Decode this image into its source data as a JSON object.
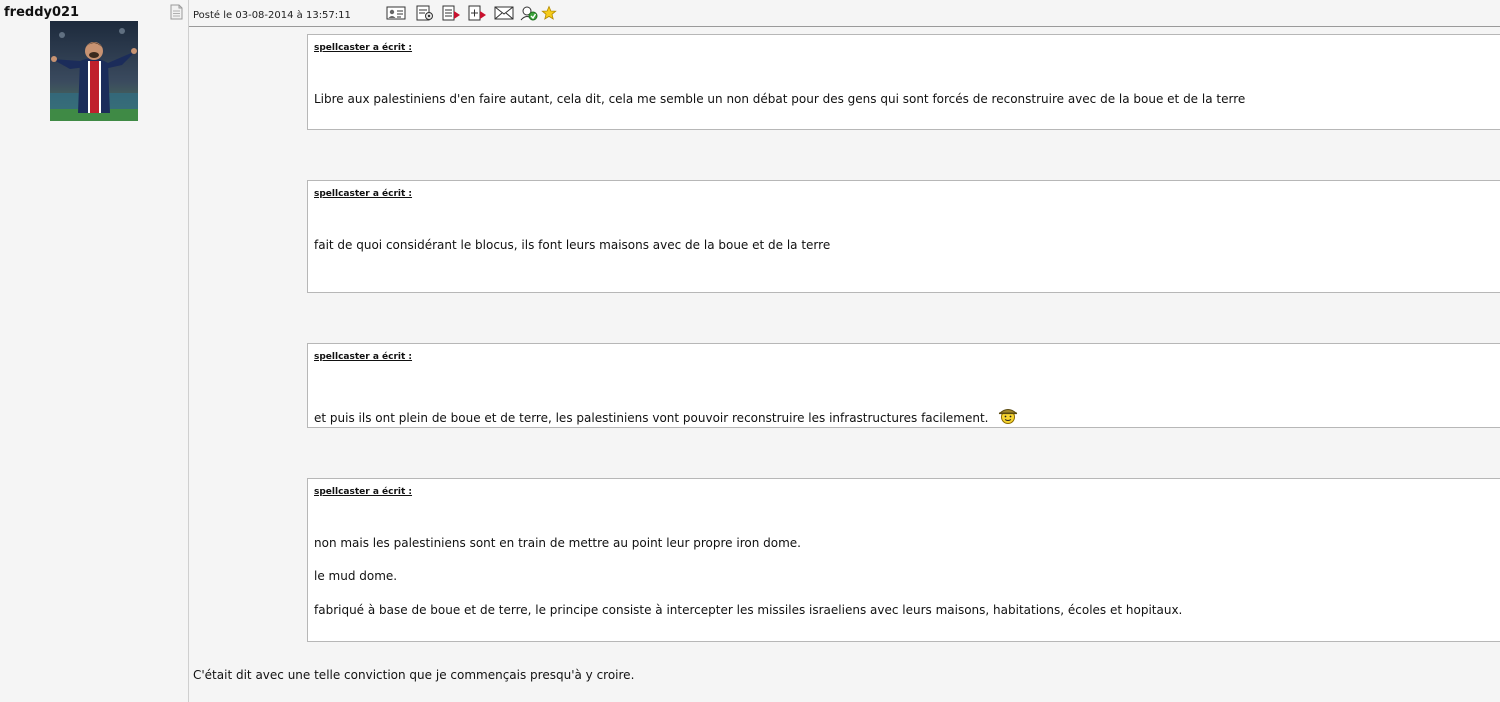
{
  "author": {
    "username": "freddy021",
    "avatar_icon": "football-player-avatar",
    "profile_icon": "profile-page-icon"
  },
  "post": {
    "posted_label": "Posté le 03-08-2014 à 13:57:11",
    "toolbar_icons": [
      "profile-card-icon",
      "contacts-icon",
      "quote-icon",
      "multi-quote-icon",
      "private-message-icon",
      "alert-icon",
      "favorite-star-icon"
    ],
    "quotes": [
      {
        "author": "spellcaster a écrit :",
        "lines": [
          "Libre aux palestiniens d'en faire autant, cela dit, cela me semble un non débat pour des gens qui sont forcés de reconstruire avec de la boue et de la terre"
        ]
      },
      {
        "author": "spellcaster a écrit :",
        "lines": [
          "fait de quoi considérant le blocus, ils font leurs maisons avec de la boue et de la terre"
        ]
      },
      {
        "author": "spellcaster a écrit :",
        "lines": [
          "et puis ils ont plein de boue et de terre, les palestiniens vont pouvoir reconstruire les infrastructures facilement."
        ],
        "smiley": "soldier-smiley-icon"
      },
      {
        "author": "spellcaster a écrit :",
        "lines": [
          "non mais les palestiniens sont en train de mettre au point leur propre iron dome.",
          "le mud dome.",
          "fabriqué à base de boue et de terre, le principe consiste à intercepter les missiles israeliens avec leurs maisons, habitations, écoles et hopitaux."
        ]
      }
    ],
    "reply": "C'était dit avec une telle conviction que je commençais presqu'à y croire."
  }
}
